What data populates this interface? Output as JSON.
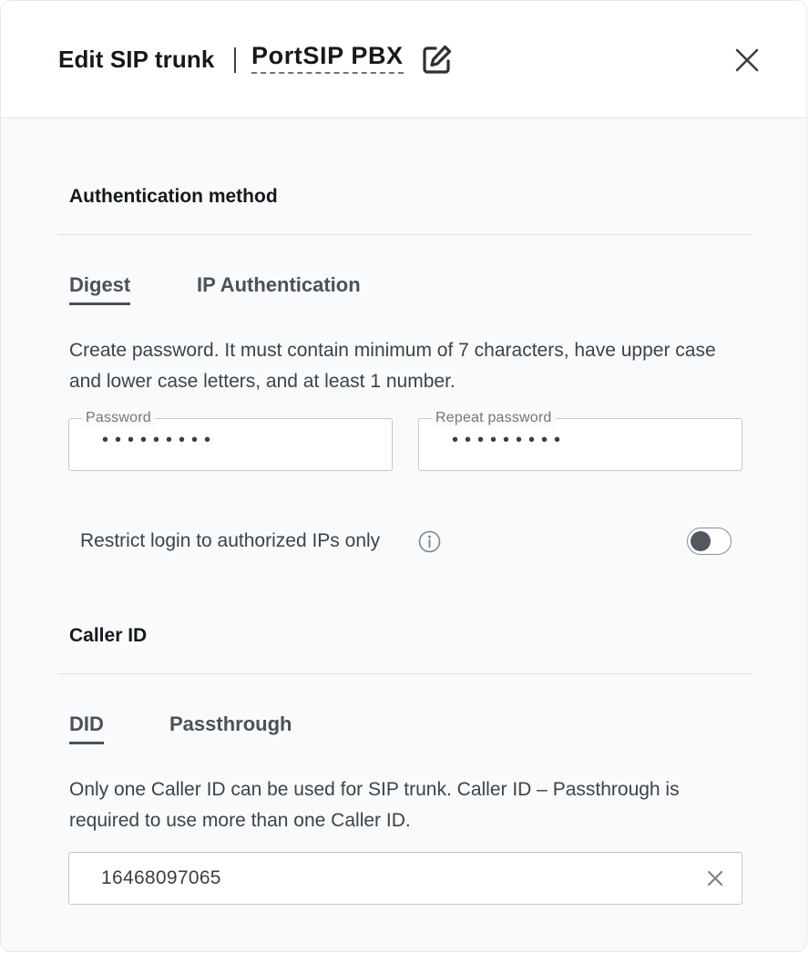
{
  "header": {
    "title": "Edit SIP trunk",
    "trunk_name": "PortSIP PBX",
    "edit_icon": "pencil-square-icon",
    "close_icon": "close-icon"
  },
  "authentication": {
    "section_title": "Authentication method",
    "tabs": [
      {
        "label": "Digest",
        "active": true
      },
      {
        "label": "IP Authentication",
        "active": false
      }
    ],
    "description": "Create password. It must contain minimum of 7 characters, have upper case and lower case letters, and at least 1 number.",
    "password": {
      "label": "Password",
      "value": "•••••••••"
    },
    "repeat_password": {
      "label": "Repeat password",
      "value": "•••••••••"
    },
    "restrict": {
      "label": "Restrict login to authorized IPs only",
      "info_icon": "info-icon",
      "enabled": false
    }
  },
  "caller_id": {
    "section_title": "Caller ID",
    "tabs": [
      {
        "label": "DID",
        "active": true
      },
      {
        "label": "Passthrough",
        "active": false
      }
    ],
    "description": "Only one Caller ID can be used for SIP trunk. Caller ID – Passthrough is required to use more than one Caller ID.",
    "selected_value": "16468097065",
    "clear_icon": "clear-icon"
  },
  "colors": {
    "background": "#f8fafb",
    "header_background": "#ffffff",
    "text_primary": "#16191c",
    "text_secondary": "#3d4348",
    "toggle_knob": "#52585d"
  }
}
